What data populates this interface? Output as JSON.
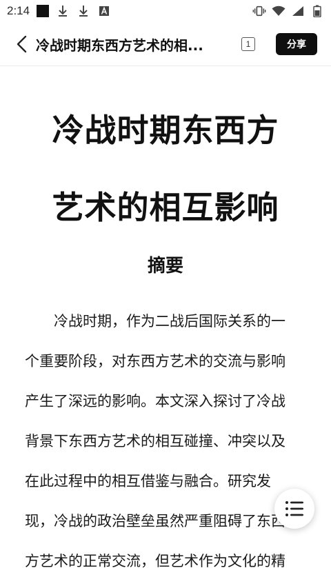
{
  "status_bar": {
    "time": "2:14",
    "icons": [
      "notification-square-icon",
      "download-icon",
      "download-icon",
      "a-icon"
    ],
    "right_icons": [
      "vibrate-icon",
      "wifi-icon",
      "signal-icon",
      "battery-icon"
    ]
  },
  "app_bar": {
    "back_icon": "chevron-left-icon",
    "title": "冷战时期东西方艺术的相...",
    "page_count": "1",
    "share_label": "分享"
  },
  "document": {
    "title_lines": [
      "冷战时期东西方",
      "艺术的相互影响"
    ],
    "section_heading": "摘要",
    "body_lines": [
      "冷战时期，作为二战后国际关系的一",
      "个重要阶段，对东西方艺术的交流与影响",
      "产生了深远的影响。本文深入探讨了冷战",
      "背景下东西方艺术的相互碰撞、冲突以及",
      "在此过程中的相互借鉴与融合。研究发",
      "现，冷战的政治壁垒虽然严重阻碍了东西",
      "方艺术的正常交流，但艺术作为文化的精"
    ]
  },
  "fab": {
    "icon": "list-menu-icon"
  },
  "colors": {
    "background": "#ffffff",
    "share_bg": "#0f0f0f",
    "text": "#111111"
  }
}
